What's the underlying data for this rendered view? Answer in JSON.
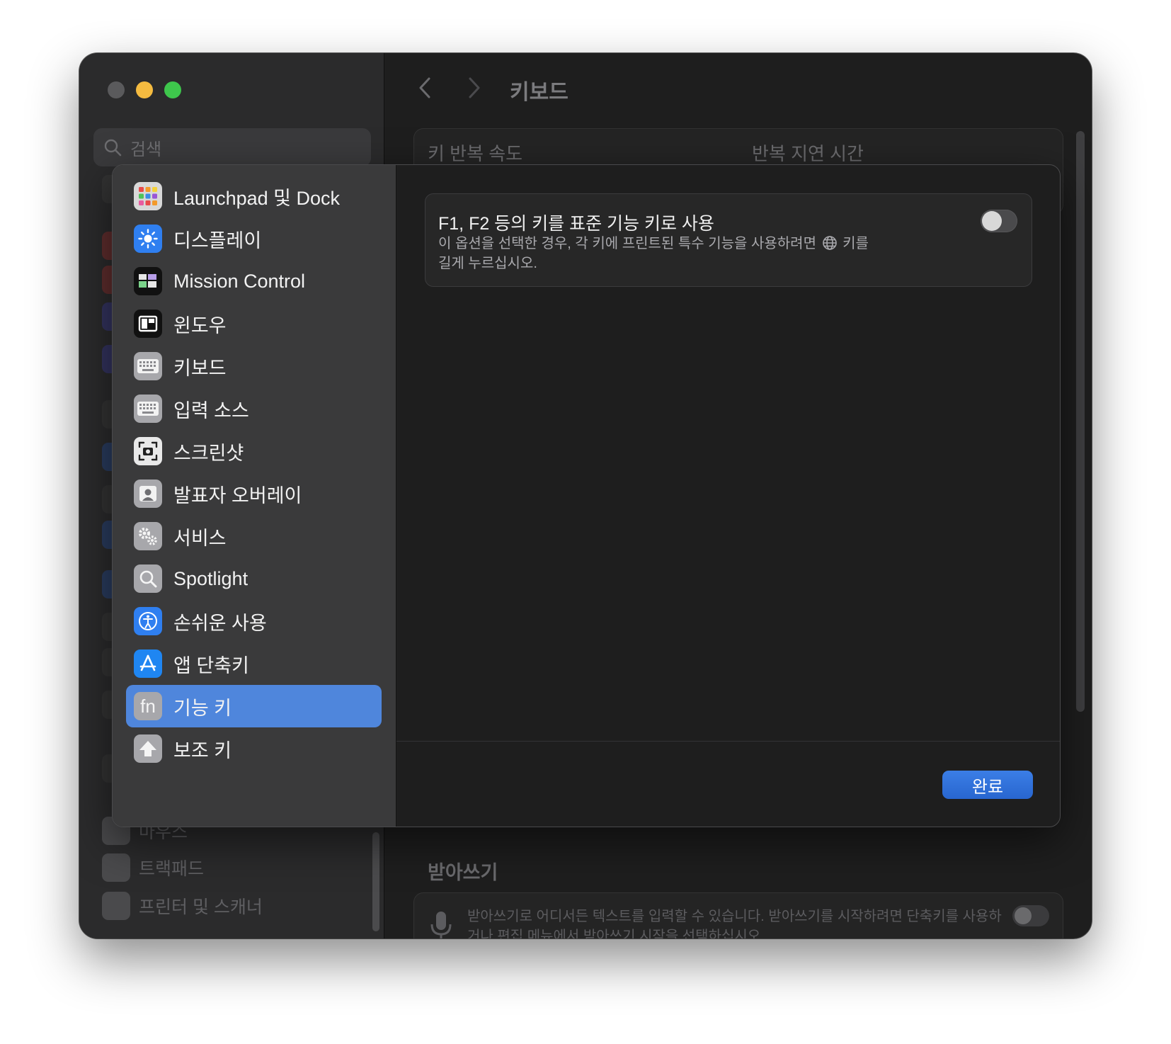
{
  "window": {
    "title": "키보드",
    "search_placeholder": "검색"
  },
  "background": {
    "key_repeat_label": "키 반복 속도",
    "repeat_delay_label": "반복 지연 시간",
    "dictation_section": "받아쓰기",
    "dictation_desc": "받아쓰기로 어디서든 텍스트를 입력할 수 있습니다. 받아쓰기를 시작하려면 단축키를 사용하거나 편집 메뉴에서 받아쓰기 시작을 선택하십시오.",
    "sidebar_partial": "마우스",
    "sidebar_trackpad": "트랙패드",
    "sidebar_printers": "프린터 및 스캐너"
  },
  "sheet": {
    "sidebar_items": [
      {
        "label": "Launchpad 및 Dock",
        "icon": "launchpad-icon"
      },
      {
        "label": "디스플레이",
        "icon": "display-icon"
      },
      {
        "label": "Mission Control",
        "icon": "mission-control-icon"
      },
      {
        "label": "윈도우",
        "icon": "window-icon"
      },
      {
        "label": "키보드",
        "icon": "keyboard-icon"
      },
      {
        "label": "입력 소스",
        "icon": "input-source-icon"
      },
      {
        "label": "스크린샷",
        "icon": "screenshot-icon"
      },
      {
        "label": "발표자 오버레이",
        "icon": "presenter-overlay-icon"
      },
      {
        "label": "서비스",
        "icon": "services-icon"
      },
      {
        "label": "Spotlight",
        "icon": "spotlight-icon"
      },
      {
        "label": "손쉬운 사용",
        "icon": "accessibility-icon"
      },
      {
        "label": "앱 단축키",
        "icon": "app-shortcuts-icon"
      },
      {
        "label": "기능 키",
        "icon": "fn-key-icon",
        "selected": true
      },
      {
        "label": "보조 키",
        "icon": "modifier-keys-icon"
      }
    ],
    "option": {
      "title": "F1, F2 등의 키를 표준 기능 키로 사용",
      "description_part1": "이 옵션을 선택한 경우, 각 키에 프린트된 특수 기능을 사용하려면",
      "description_part2": "키를",
      "description_part3": "길게 누르십시오.",
      "toggle_on": false
    },
    "done_label": "완료"
  },
  "colors": {
    "accent": "#4f86dc",
    "button": "#2a6fdb",
    "traffic_min": "#f5bb40",
    "traffic_max": "#3ec64c"
  }
}
